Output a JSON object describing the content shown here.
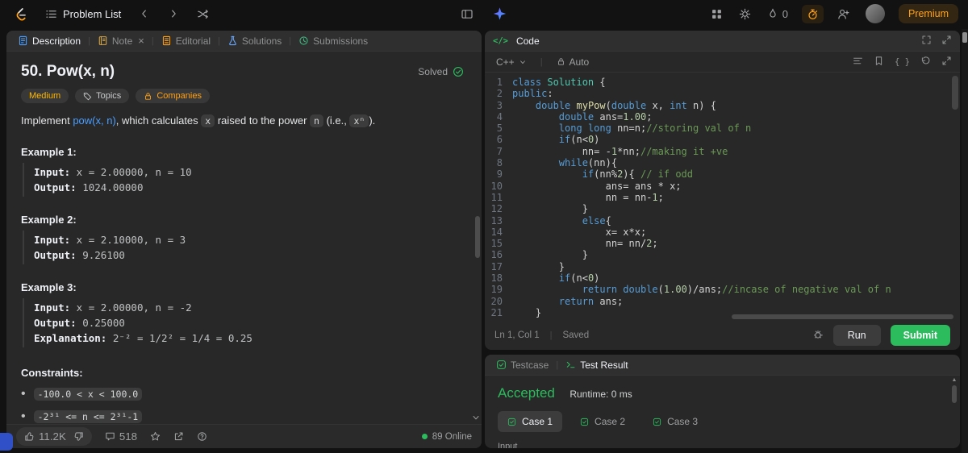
{
  "icons": {
    "divider": "|",
    "bullet": "•",
    "close": "×",
    "code_tag": "</>",
    "braces": "{ }",
    "arrow_up": "▲"
  },
  "topbar": {
    "problem_list_label": "Problem List",
    "streak_count": "0",
    "premium_label": "Premium"
  },
  "description": {
    "tabs": {
      "description": "Description",
      "note": "Note",
      "editorial": "Editorial",
      "solutions": "Solutions",
      "submissions": "Submissions"
    },
    "title": "50. Pow(x, n)",
    "solved_label": "Solved",
    "badges": {
      "difficulty": "Medium",
      "topics": "Topics",
      "companies": "Companies"
    },
    "statement": {
      "t0": "Implement ",
      "link": "pow(x, n)",
      "t1": ", which calculates ",
      "code1": "x",
      "t2": " raised to the power ",
      "code2": "n",
      "t3": " (i.e., ",
      "code3": "xⁿ",
      "t4": ")."
    },
    "examples": [
      {
        "label": "Example 1:",
        "input_label": "Input:",
        "input": " x = 2.00000, n = 10",
        "output_label": "Output:",
        "output": " 1024.00000"
      },
      {
        "label": "Example 2:",
        "input_label": "Input:",
        "input": " x = 2.10000, n = 3",
        "output_label": "Output:",
        "output": " 9.26100"
      },
      {
        "label": "Example 3:",
        "input_label": "Input:",
        "input": " x = 2.00000, n = -2",
        "output_label": "Output:",
        "output": " 0.25000",
        "explanation_label": "Explanation:",
        "explanation": " 2⁻² = 1/2² = 1/4 = 0.25"
      }
    ],
    "constraints_title": "Constraints:",
    "constraints": [
      "-100.0 < x < 100.0",
      "-2³¹ <= n <= 2³¹-1"
    ],
    "footer": {
      "likes": "11.2K",
      "comments": "518",
      "online": "89 Online"
    }
  },
  "code": {
    "header_label": "Code",
    "language": "C++",
    "auto_label": "Auto",
    "lines": [
      [
        [
          "kw",
          "class"
        ],
        [
          "pl",
          " "
        ],
        [
          "ty",
          "Solution"
        ],
        [
          "pl",
          " {"
        ]
      ],
      [
        [
          "kw",
          "public"
        ],
        [
          "pl",
          ":"
        ]
      ],
      [
        [
          "pl",
          "    "
        ],
        [
          "kw",
          "double"
        ],
        [
          "pl",
          " "
        ],
        [
          "fn",
          "myPow"
        ],
        [
          "pl",
          "("
        ],
        [
          "kw",
          "double"
        ],
        [
          "pl",
          " x, "
        ],
        [
          "kw",
          "int"
        ],
        [
          "pl",
          " n) {"
        ]
      ],
      [
        [
          "pl",
          "        "
        ],
        [
          "kw",
          "double"
        ],
        [
          "pl",
          " ans="
        ],
        [
          "num",
          "1.00"
        ],
        [
          "pl",
          ";"
        ]
      ],
      [
        [
          "pl",
          "        "
        ],
        [
          "kw",
          "long"
        ],
        [
          "pl",
          " "
        ],
        [
          "kw",
          "long"
        ],
        [
          "pl",
          " nn=n;"
        ],
        [
          "cm",
          "//storing val of n"
        ]
      ],
      [
        [
          "pl",
          "        "
        ],
        [
          "kw",
          "if"
        ],
        [
          "pl",
          "(n<"
        ],
        [
          "num",
          "0"
        ],
        [
          "pl",
          ")"
        ]
      ],
      [
        [
          "pl",
          "            nn= -"
        ],
        [
          "num",
          "1"
        ],
        [
          "pl",
          "*nn;"
        ],
        [
          "cm",
          "//making it +ve"
        ]
      ],
      [
        [
          "pl",
          "        "
        ],
        [
          "kw",
          "while"
        ],
        [
          "pl",
          "(nn){"
        ]
      ],
      [
        [
          "pl",
          "            "
        ],
        [
          "kw",
          "if"
        ],
        [
          "pl",
          "(nn%"
        ],
        [
          "num",
          "2"
        ],
        [
          "pl",
          "){ "
        ],
        [
          "cm",
          "// if odd"
        ]
      ],
      [
        [
          "pl",
          "                ans= ans * x;"
        ]
      ],
      [
        [
          "pl",
          "                nn = nn-"
        ],
        [
          "num",
          "1"
        ],
        [
          "pl",
          ";"
        ]
      ],
      [
        [
          "pl",
          "            }"
        ]
      ],
      [
        [
          "pl",
          "            "
        ],
        [
          "kw",
          "else"
        ],
        [
          "pl",
          "{"
        ]
      ],
      [
        [
          "pl",
          "                x= x*x;"
        ]
      ],
      [
        [
          "pl",
          "                nn= nn/"
        ],
        [
          "num",
          "2"
        ],
        [
          "pl",
          ";"
        ]
      ],
      [
        [
          "pl",
          "            }"
        ]
      ],
      [
        [
          "pl",
          "        }"
        ]
      ],
      [
        [
          "pl",
          "        "
        ],
        [
          "kw",
          "if"
        ],
        [
          "pl",
          "(n<"
        ],
        [
          "num",
          "0"
        ],
        [
          "pl",
          ")"
        ]
      ],
      [
        [
          "pl",
          "            "
        ],
        [
          "kw",
          "return"
        ],
        [
          "pl",
          " "
        ],
        [
          "kw",
          "double"
        ],
        [
          "pl",
          "("
        ],
        [
          "num",
          "1.00"
        ],
        [
          "pl",
          ")/ans;"
        ],
        [
          "cm",
          "//incase of negative val of n"
        ]
      ],
      [
        [
          "pl",
          "        "
        ],
        [
          "kw",
          "return"
        ],
        [
          "pl",
          " ans;"
        ]
      ],
      [
        [
          "pl",
          "    }"
        ]
      ]
    ],
    "status": {
      "position": "Ln 1, Col 1",
      "saved": "Saved",
      "run_label": "Run",
      "submit_label": "Submit"
    }
  },
  "result": {
    "tabs": {
      "testcase": "Testcase",
      "test_result": "Test Result"
    },
    "status_label": "Accepted",
    "runtime_label": "Runtime: 0 ms",
    "cases": [
      "Case 1",
      "Case 2",
      "Case 3"
    ],
    "input_label": "Input"
  }
}
